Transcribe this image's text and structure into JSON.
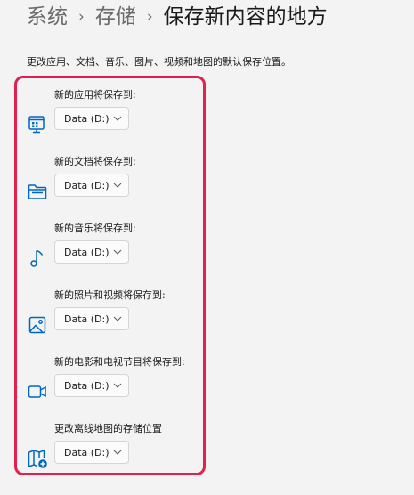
{
  "breadcrumb": {
    "items": [
      "系统",
      "存储"
    ],
    "separator": "›",
    "current": "保存新内容的地方"
  },
  "description": "更改应用、文档、音乐、图片、视频和地图的默认保存位置。",
  "accent_color": "#0067c0",
  "highlight_color": "#e2204e",
  "groups": [
    {
      "label": "新的应用将保存到:",
      "value": "Data (D:)",
      "icon": "apps-icon"
    },
    {
      "label": "新的文档将保存到:",
      "value": "Data (D:)",
      "icon": "folder-icon"
    },
    {
      "label": "新的音乐将保存到:",
      "value": "Data (D:)",
      "icon": "music-note-icon"
    },
    {
      "label": "新的照片和视频将保存到:",
      "value": "Data (D:)",
      "icon": "photo-icon"
    },
    {
      "label": "新的电影和电视节目将保存到:",
      "value": "Data (D:)",
      "icon": "video-camera-icon"
    },
    {
      "label": "更改离线地图的存储位置",
      "value": "Data (D:)",
      "icon": "offline-map-icon"
    }
  ]
}
